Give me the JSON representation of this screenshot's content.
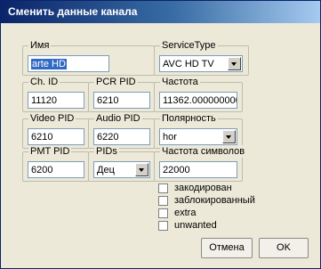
{
  "window": {
    "title": "Сменить данные канала"
  },
  "fields": {
    "name": {
      "label": "Имя",
      "value": "arte HD"
    },
    "service_type": {
      "label": "ServiceType",
      "value": "AVC HD TV"
    },
    "ch_id": {
      "label": "Ch. ID",
      "value": "11120"
    },
    "pcr_pid": {
      "label": "PCR PID",
      "value": "6210"
    },
    "frequency": {
      "label": "Частота",
      "value": "11362.000000000"
    },
    "video_pid": {
      "label": "Video PID",
      "value": "6210"
    },
    "audio_pid": {
      "label": "Audio PID",
      "value": "6220"
    },
    "polarity": {
      "label": "Полярность",
      "value": "hor"
    },
    "pmt_pid": {
      "label": "PMT PID",
      "value": "6200"
    },
    "pids": {
      "label": "PIDs",
      "value": "Дец"
    },
    "symbol_rate": {
      "label": "Частота символов",
      "value": "22000"
    }
  },
  "checkboxes": [
    {
      "label": "закодирован",
      "checked": false
    },
    {
      "label": "заблокированный",
      "checked": false
    },
    {
      "label": "extra",
      "checked": false
    },
    {
      "label": "unwanted",
      "checked": false
    }
  ],
  "buttons": {
    "cancel": "Отмена",
    "ok": "OK"
  }
}
